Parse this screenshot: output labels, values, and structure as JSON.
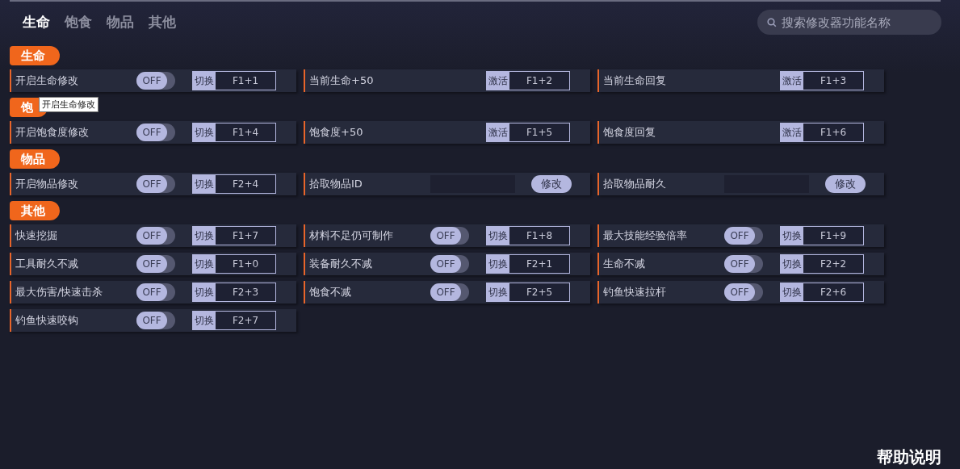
{
  "tabs": [
    {
      "label": "生命",
      "selected": true
    },
    {
      "label": "饱食",
      "selected": false
    },
    {
      "label": "物品",
      "selected": false
    },
    {
      "label": "其他",
      "selected": false
    }
  ],
  "search": {
    "placeholder": "搜索修改器功能名称"
  },
  "sections": [
    {
      "title": "生命",
      "items": [
        {
          "kind": "toggle",
          "label": "开启生命修改",
          "on": false,
          "state_text": "OFF",
          "key_label": "切换",
          "hotkey": "F1+1",
          "tooltip": "开启生命修改"
        },
        {
          "kind": "action",
          "label": "当前生命+50",
          "key_label": "激活",
          "hotkey": "F1+2"
        },
        {
          "kind": "action",
          "label": "当前生命回复",
          "key_label": "激活",
          "hotkey": "F1+3"
        }
      ]
    },
    {
      "title": "饱",
      "items": [
        {
          "kind": "toggle",
          "label": "开启饱食度修改",
          "on": false,
          "state_text": "OFF",
          "key_label": "切换",
          "hotkey": "F1+4"
        },
        {
          "kind": "action",
          "label": "饱食度+50",
          "key_label": "激活",
          "hotkey": "F1+5"
        },
        {
          "kind": "action",
          "label": "饱食度回复",
          "key_label": "激活",
          "hotkey": "F1+6"
        }
      ]
    },
    {
      "title": "物品",
      "items": [
        {
          "kind": "toggle",
          "label": "开启物品修改",
          "on": false,
          "state_text": "OFF",
          "key_label": "切换",
          "hotkey": "F2+4"
        },
        {
          "kind": "input",
          "label": "拾取物品ID",
          "button": "修改"
        },
        {
          "kind": "input",
          "label": "拾取物品耐久",
          "button": "修改"
        }
      ]
    },
    {
      "title": "其他",
      "items": [
        {
          "kind": "toggle",
          "label": "快速挖掘",
          "on": false,
          "state_text": "OFF",
          "key_label": "切换",
          "hotkey": "F1+7"
        },
        {
          "kind": "toggle",
          "label": "材料不足仍可制作",
          "on": false,
          "state_text": "OFF",
          "key_label": "切换",
          "hotkey": "F1+8"
        },
        {
          "kind": "toggle",
          "label": "最大技能经验倍率",
          "on": false,
          "state_text": "OFF",
          "key_label": "切换",
          "hotkey": "F1+9"
        },
        {
          "kind": "toggle",
          "label": "工具耐久不减",
          "on": false,
          "state_text": "OFF",
          "key_label": "切换",
          "hotkey": "F1+0"
        },
        {
          "kind": "toggle",
          "label": "装备耐久不减",
          "on": false,
          "state_text": "OFF",
          "key_label": "切换",
          "hotkey": "F2+1"
        },
        {
          "kind": "toggle",
          "label": "生命不减",
          "on": false,
          "state_text": "OFF",
          "key_label": "切换",
          "hotkey": "F2+2"
        },
        {
          "kind": "toggle",
          "label": "最大伤害/快速击杀",
          "on": false,
          "state_text": "OFF",
          "key_label": "切换",
          "hotkey": "F2+3"
        },
        {
          "kind": "toggle",
          "label": "饱食不减",
          "on": false,
          "state_text": "OFF",
          "key_label": "切换",
          "hotkey": "F2+5"
        },
        {
          "kind": "toggle",
          "label": "钓鱼快速拉杆",
          "on": false,
          "state_text": "OFF",
          "key_label": "切换",
          "hotkey": "F2+6"
        },
        {
          "kind": "toggle",
          "label": "钓鱼快速咬钩",
          "on": false,
          "state_text": "OFF",
          "key_label": "切换",
          "hotkey": "F2+7"
        }
      ]
    }
  ],
  "help": "帮助说明"
}
